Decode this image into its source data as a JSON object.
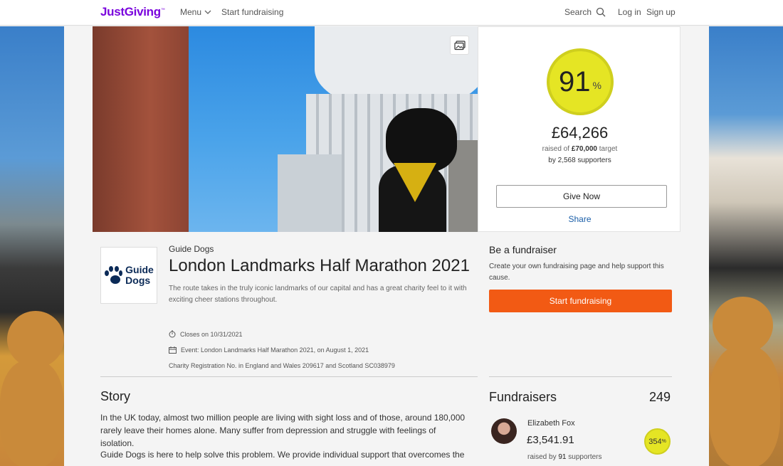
{
  "header": {
    "logo": "JustGiving",
    "menu_label": "Menu",
    "start_fundraising": "Start fundraising",
    "search_label": "Search",
    "login": "Log in",
    "signup": "Sign up"
  },
  "stats": {
    "percent": "91",
    "percent_symbol": "%",
    "percent_value": 0.91,
    "raised": "£64,266",
    "target_prefix": "raised of",
    "target_amount": "£70,000",
    "target_suffix": "target",
    "supporters_prefix": "by",
    "supporters_count": "2,568",
    "supporters_suffix": "supporters",
    "give_now": "Give Now",
    "share": "Share"
  },
  "charity": {
    "logo_line1": "Guide",
    "logo_line2": "Dogs",
    "name": "Guide Dogs",
    "event_title": "London Landmarks Half Marathon 2021",
    "description": "The route takes in the truly iconic landmarks of our capital and has a great charity feel to it with exciting cheer stations throughout.",
    "closes": "Closes on 10/31/2021",
    "event": "Event: London Landmarks Half Marathon 2021, on August 1, 2021",
    "registration": "Charity Registration No. in England and Wales 209617 and Scotland SC038979"
  },
  "be_fundraiser": {
    "title": "Be a fundraiser",
    "description": "Create your own fundraising page and help support this cause.",
    "button": "Start fundraising"
  },
  "story": {
    "title": "Story",
    "paragraph1": "In the UK today, almost two million people are living with sight loss and of those, around 180,000 rarely leave their homes alone. Many suffer from depression and struggle with feelings of isolation.",
    "paragraph2": "Guide Dogs is here to help solve this problem. We provide individual support that overcomes the"
  },
  "fundraisers": {
    "title": "Fundraisers",
    "count": "249",
    "items": [
      {
        "name": "Elizabeth Fox",
        "amount": "£3,541.91",
        "raised_prefix": "raised by",
        "supporters": "91",
        "raised_suffix": "supporters",
        "percent": "354",
        "percent_symbol": "%"
      }
    ]
  },
  "colors": {
    "brand": "#7a04dd",
    "progress": "#e5e524",
    "cta": "#f25a14",
    "link": "#1a5ea8"
  },
  "icons": [
    "chevron-down-icon",
    "search-icon",
    "image-gallery-icon",
    "stopwatch-icon",
    "calendar-icon",
    "paw-icon"
  ]
}
